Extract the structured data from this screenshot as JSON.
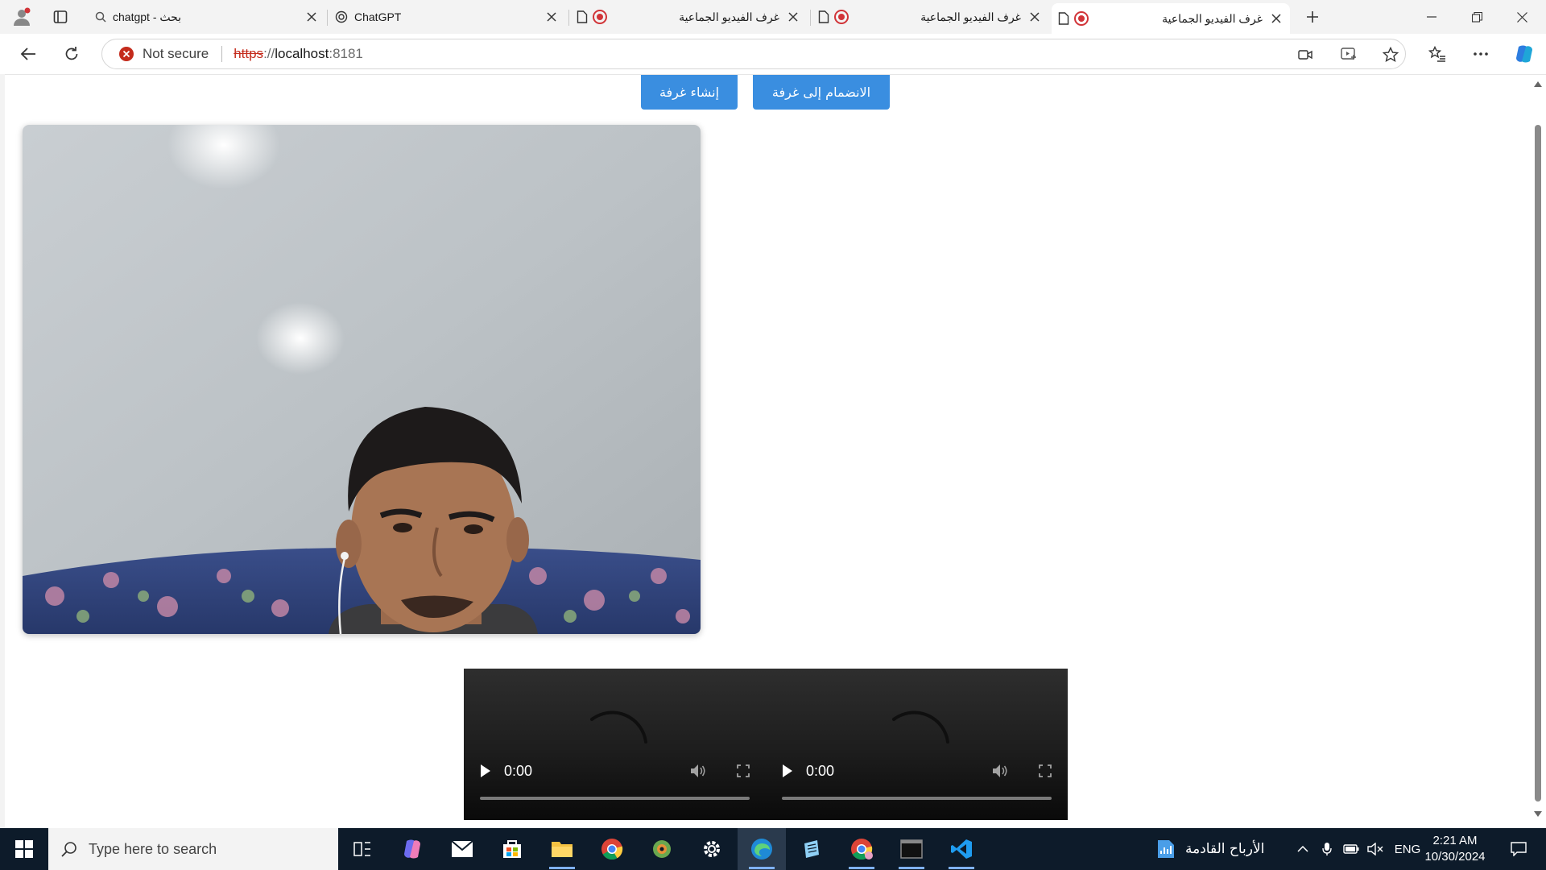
{
  "tabs": [
    {
      "title": "chatgpt - بحث",
      "icon": "search-icon"
    },
    {
      "title": "ChatGPT",
      "icon": "chatgpt-icon"
    },
    {
      "title": "غرف الفيديو الجماعية",
      "icon": "page-icon",
      "recording": true
    },
    {
      "title": "غرف الفيديو الجماعية",
      "icon": "page-icon",
      "recording": true
    },
    {
      "title": "غرف الفيديو الجماعية",
      "icon": "page-icon",
      "recording": true,
      "active": true
    }
  ],
  "address_bar": {
    "security_label": "Not secure",
    "url_scheme": "https",
    "url_sep": "://",
    "url_host": "localhost",
    "url_port": ":8181"
  },
  "page": {
    "join_room_label": "الانضمام إلى غرفة",
    "create_room_label": "إنشاء غرفة",
    "remote_videos": [
      {
        "time": "0:00"
      },
      {
        "time": "0:00"
      }
    ]
  },
  "taskbar": {
    "search_placeholder": "Type here to search",
    "weather_text": "الأرباح القادمة",
    "language": "ENG",
    "time": "2:21 AM",
    "date": "10/30/2024"
  },
  "colors": {
    "accent_button": "#3a8ee0",
    "not_secure_red": "#c42b1c",
    "taskbar_bg": "#0d1b2a"
  }
}
